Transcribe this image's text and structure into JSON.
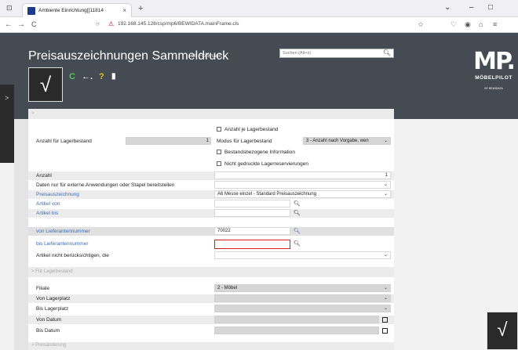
{
  "browser": {
    "tab_title": "Ambiente Einrichtung[[11814 ·",
    "tab_close": "×",
    "new_tab": "+",
    "url": "192.168.145.128/csp/mp6/BEWIDATA.mainFrame.cls",
    "back": "←",
    "forward": "→",
    "reload": "C",
    "min": "–",
    "max": "□",
    "menu": "⌄"
  },
  "header": {
    "title": "Preisauszeichnungen Sammeldruck",
    "user": "Uli Flottmann",
    "search_placeholder": "Suchen (Alt+s)",
    "confirm": "√",
    "refresh": "C",
    "back": "←.",
    "help": "?",
    "logo_mp": "MP.",
    "logo_name": "MÖBELPILOT",
    "logo_by": "BY BEWIDATA"
  },
  "form": {
    "section1_chevron": ">",
    "cb_anzahl_je_lager": "Anzahl je Lagerbestand",
    "anzahl_lager_label": "Anzahl für Lagerbestand",
    "anzahl_lager_value": "1",
    "modus_label": "Modus für Lagerbestand",
    "modus_value": "3 - Anzahl nach Vorgabe, wen",
    "cb_bestand": "Bestandsbezogene Information",
    "cb_nicht_gedruckt": "Nicht gedruckte Lagerreservierungen",
    "anzahl_label": "Anzahl",
    "anzahl_value": "1",
    "daten_label": "Daten nur für externe Anwendungen oder Stapel bereitstellen",
    "preisauszeichnung_label": "Preisauszeichnung",
    "preisauszeichnung_value": "A6 Messe einzel - Standard Preisauszeichnung",
    "artikel_von_label": "Artikel von",
    "artikel_bis_label": "Artikel bis",
    "von_lief_label": "von Lieferantennummer",
    "von_lief_value": "70022",
    "bis_lief_label": "bis Lieferantennummer",
    "bis_lief_value": "",
    "artikel_nicht_label": "Artikel nicht berücksichtigen, die",
    "section2_label": "> Für Lagerbestand",
    "filiale_label": "Filiale",
    "filiale_value": "2 - Möbel",
    "von_lagerplatz_label": "Von Lagerplatz",
    "bis_lagerplatz_label": "Bis Lagerplatz",
    "von_datum_label": "Von Datum",
    "bis_datum_label": "Bis Datum",
    "section3_label": "> Preisänderung"
  }
}
